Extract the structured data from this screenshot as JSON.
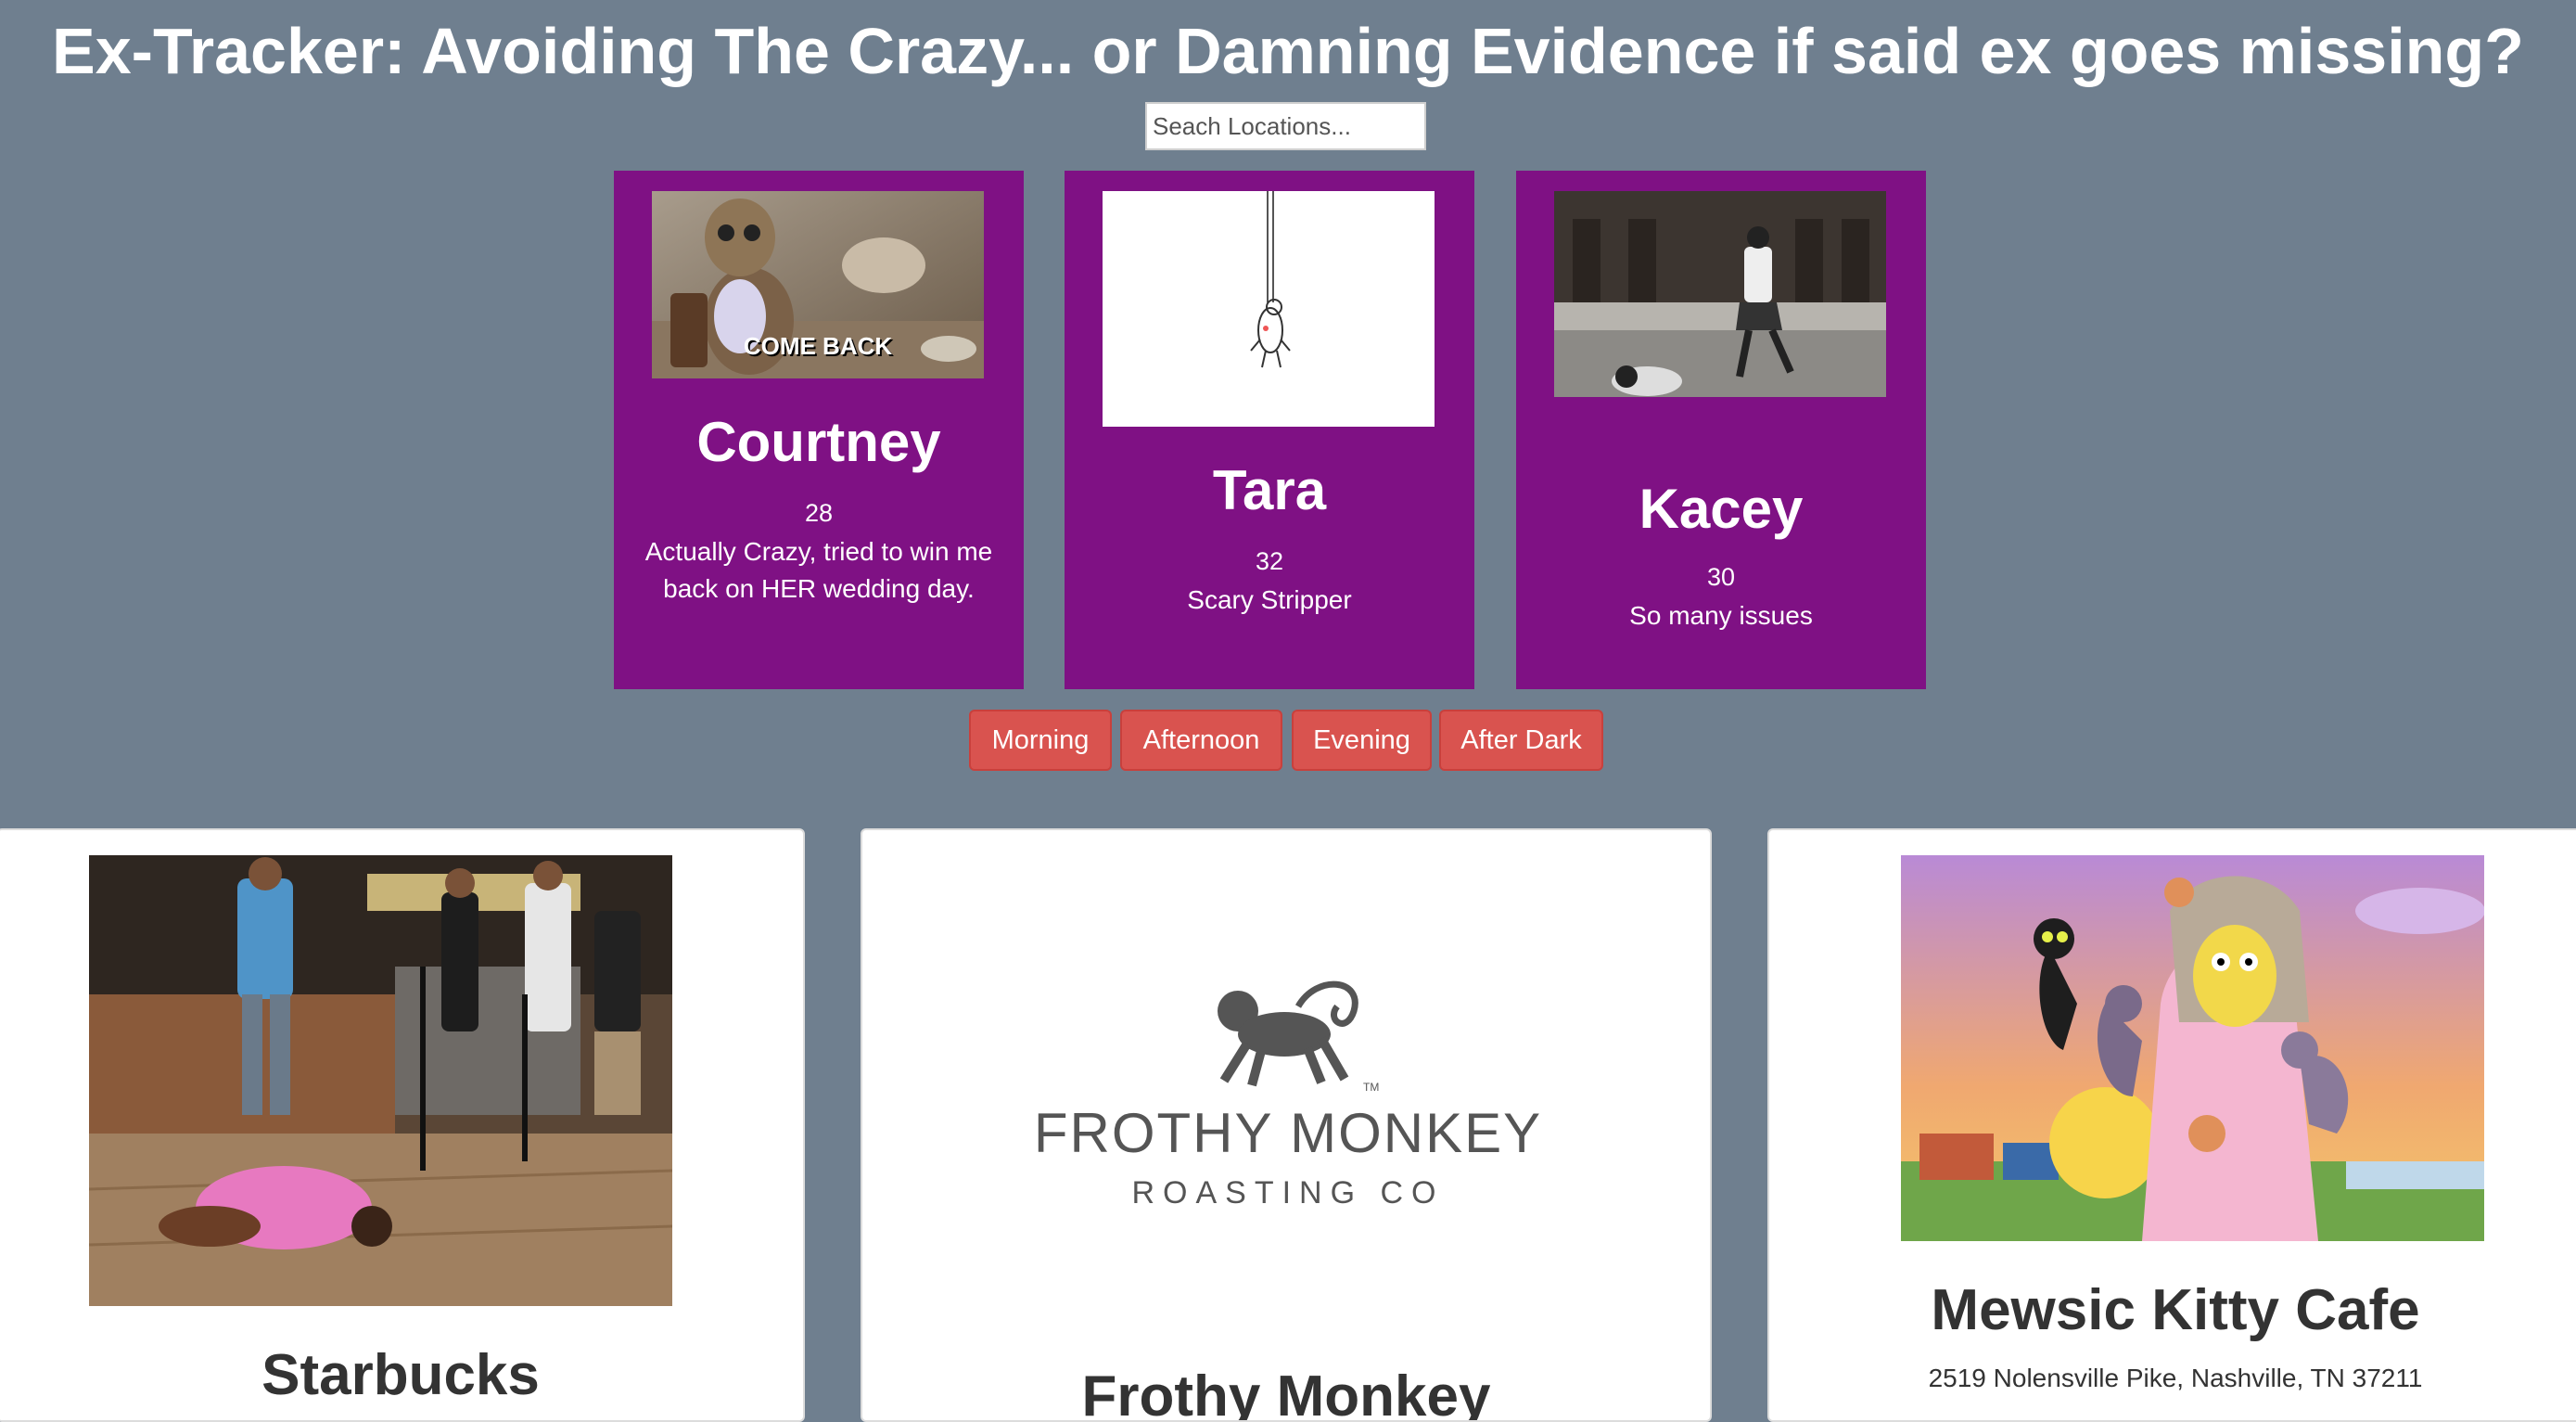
{
  "header": {
    "title": "Ex-Tracker: Avoiding The Crazy... or Damning Evidence if said ex goes missing?",
    "search_placeholder": "Seach Locations..."
  },
  "exes": [
    {
      "name": "Courtney",
      "age": "28",
      "description": "Actually Crazy, tried to win me back on HER wedding day.",
      "image_caption": "COME BACK"
    },
    {
      "name": "Tara",
      "age": "32",
      "description": "Scary Stripper"
    },
    {
      "name": "Kacey",
      "age": "30",
      "description": "So many issues"
    }
  ],
  "time_filters": [
    "Morning",
    "Afternoon",
    "Evening",
    "After Dark"
  ],
  "locations": [
    {
      "name": "Starbucks"
    },
    {
      "name": "Frothy Monkey",
      "logo_line1": "FROTHY MONKEY",
      "logo_line2": "ROASTING CO",
      "logo_tm": "TM"
    },
    {
      "name": "Mewsic Kitty Cafe",
      "address": "2519 Nolensville Pike, Nashville, TN 37211"
    }
  ],
  "colors": {
    "background": "#6f7f8f",
    "ex_card": "#7f1184",
    "button": "#d9534f"
  }
}
